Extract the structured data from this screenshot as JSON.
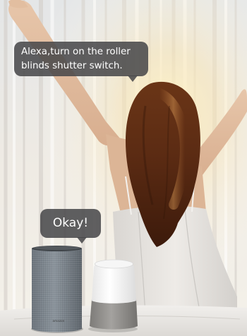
{
  "speech": {
    "command_text": "Alexa,turn on the roller blinds shutter switch.",
    "reply_text": "Okay!"
  },
  "speaker": {
    "echo_brand": "amazon"
  },
  "colors": {
    "bubble_bg": "#464648",
    "bubble_text": "#ffffff",
    "curtain": "#ece8df",
    "hair": "#4a2312",
    "dress": "#e9e6e2",
    "echo_fabric": "#7f8891",
    "home_fabric": "#8f8d8a"
  },
  "icons": {
    "echo": "amazon-echo-speaker",
    "home": "google-home-speaker"
  }
}
